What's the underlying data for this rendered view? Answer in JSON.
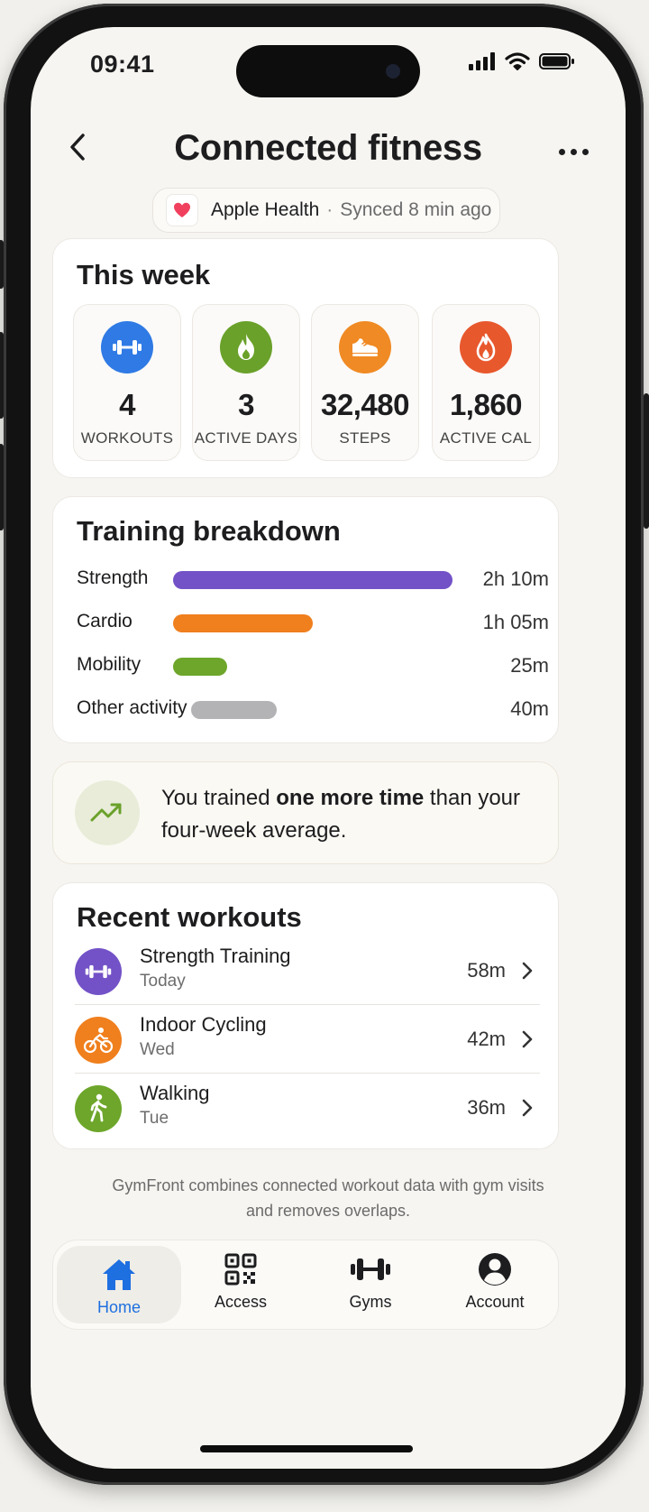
{
  "status_bar": {
    "time": "09:41"
  },
  "header": {
    "title": "Connected fitness"
  },
  "sync": {
    "source": "Apple Health",
    "separator": "·",
    "status": "Synced 8 min ago"
  },
  "this_week": {
    "title": "This week",
    "stats": [
      {
        "value": "4",
        "label": "WORKOUTS",
        "icon": "dumbbell-icon",
        "color": "#2f7ae5"
      },
      {
        "value": "3",
        "label": "ACTIVE DAYS",
        "icon": "flame-icon",
        "color": "#6aa12a"
      },
      {
        "value": "32,480",
        "label": "STEPS",
        "icon": "shoe-icon",
        "color": "#f08a24"
      },
      {
        "value": "1,860",
        "label": "ACTIVE CAL",
        "icon": "fire-drop-icon",
        "color": "#e8582d"
      }
    ]
  },
  "breakdown": {
    "title": "Training breakdown",
    "items": [
      {
        "label": "Strength",
        "duration": "2h 10m",
        "minutes": 130,
        "color": "#7352c7"
      },
      {
        "label": "Cardio",
        "duration": "1h 05m",
        "minutes": 65,
        "color": "#f07f1d"
      },
      {
        "label": "Mobility",
        "duration": "25m",
        "minutes": 25,
        "color": "#6da62a"
      },
      {
        "label": "Other activity",
        "duration": "40m",
        "minutes": 40,
        "color": "#b3b3b5"
      }
    ]
  },
  "insight": {
    "prefix": "You trained ",
    "emphasis": "one more time",
    "suffix": " than your four-week average."
  },
  "recent": {
    "title": "Recent workouts",
    "items": [
      {
        "name": "Strength Training",
        "day": "Today",
        "duration": "58m",
        "icon": "dumbbell-icon",
        "color": "#7352c7"
      },
      {
        "name": "Indoor Cycling",
        "day": "Wed",
        "duration": "42m",
        "icon": "cyclist-icon",
        "color": "#f07f1d"
      },
      {
        "name": "Walking",
        "day": "Tue",
        "duration": "36m",
        "icon": "walker-icon",
        "color": "#6da62a"
      }
    ]
  },
  "footer_note": "GymFront combines connected workout data with gym visits and removes overlaps.",
  "tabs": [
    {
      "label": "Home",
      "icon": "home-icon",
      "active": true
    },
    {
      "label": "Access",
      "icon": "qr-code-icon",
      "active": false
    },
    {
      "label": "Gyms",
      "icon": "dumbbell-icon",
      "active": false
    },
    {
      "label": "Account",
      "icon": "account-icon",
      "active": false
    }
  ],
  "colors": {
    "accent": "#1e6fe0",
    "background": "#f7f5f1"
  }
}
